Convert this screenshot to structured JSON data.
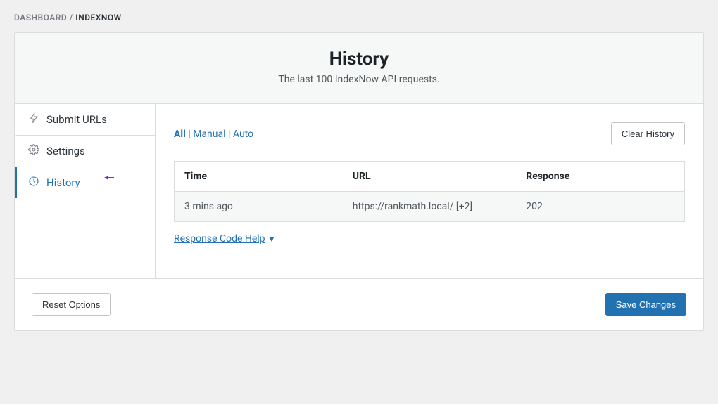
{
  "breadcrumb": {
    "root": "DASHBOARD",
    "separator": " / ",
    "current": "INDEXNOW"
  },
  "header": {
    "title": "History",
    "subtitle": "The last 100 IndexNow API requests."
  },
  "sidebar": {
    "items": [
      {
        "label": "Submit URLs"
      },
      {
        "label": "Settings"
      },
      {
        "label": "History"
      }
    ]
  },
  "filters": {
    "all": "All",
    "manual": "Manual",
    "auto": "Auto",
    "sep": " | "
  },
  "buttons": {
    "clear_history": "Clear History",
    "reset_options": "Reset Options",
    "save_changes": "Save Changes"
  },
  "table": {
    "headers": {
      "time": "Time",
      "url": "URL",
      "response": "Response"
    },
    "rows": [
      {
        "time": "3 mins ago",
        "url": "https://rankmath.local/ [+2]",
        "response": "202"
      }
    ]
  },
  "help": {
    "label": "Response Code Help"
  }
}
